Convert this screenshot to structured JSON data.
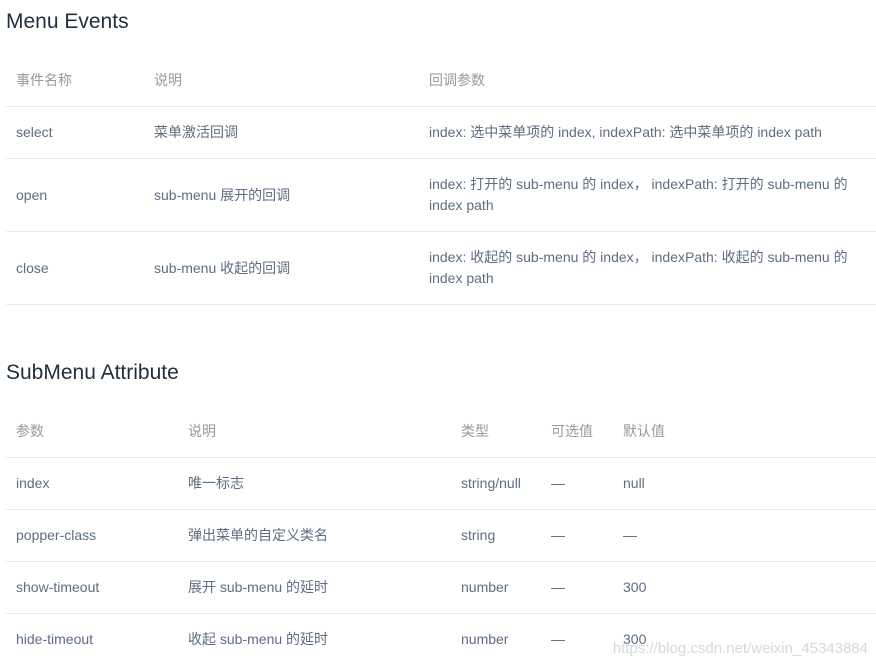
{
  "events": {
    "title": "Menu Events",
    "headers": [
      "事件名称",
      "说明",
      "回调参数"
    ],
    "rows": [
      [
        "select",
        "菜单激活回调",
        "index: 选中菜单项的 index, indexPath: 选中菜单项的 index path"
      ],
      [
        "open",
        "sub-menu 展开的回调",
        "index: 打开的 sub-menu 的 index， indexPath: 打开的 sub-menu 的 index path"
      ],
      [
        "close",
        "sub-menu 收起的回调",
        "index: 收起的 sub-menu 的 index， indexPath: 收起的 sub-menu 的 index path"
      ]
    ]
  },
  "submenu": {
    "title": "SubMenu Attribute",
    "headers": [
      "参数",
      "说明",
      "类型",
      "可选值",
      "默认值"
    ],
    "rows": [
      [
        "index",
        "唯一标志",
        "string/null",
        "—",
        "null"
      ],
      [
        "popper-class",
        "弹出菜单的自定义类名",
        "string",
        "—",
        "—"
      ],
      [
        "show-timeout",
        "展开 sub-menu 的延时",
        "number",
        "—",
        "300"
      ],
      [
        "hide-timeout",
        "收起 sub-menu 的延时",
        "number",
        "—",
        "300"
      ]
    ]
  },
  "watermark": "https://blog.csdn.net/weixin_45343884"
}
